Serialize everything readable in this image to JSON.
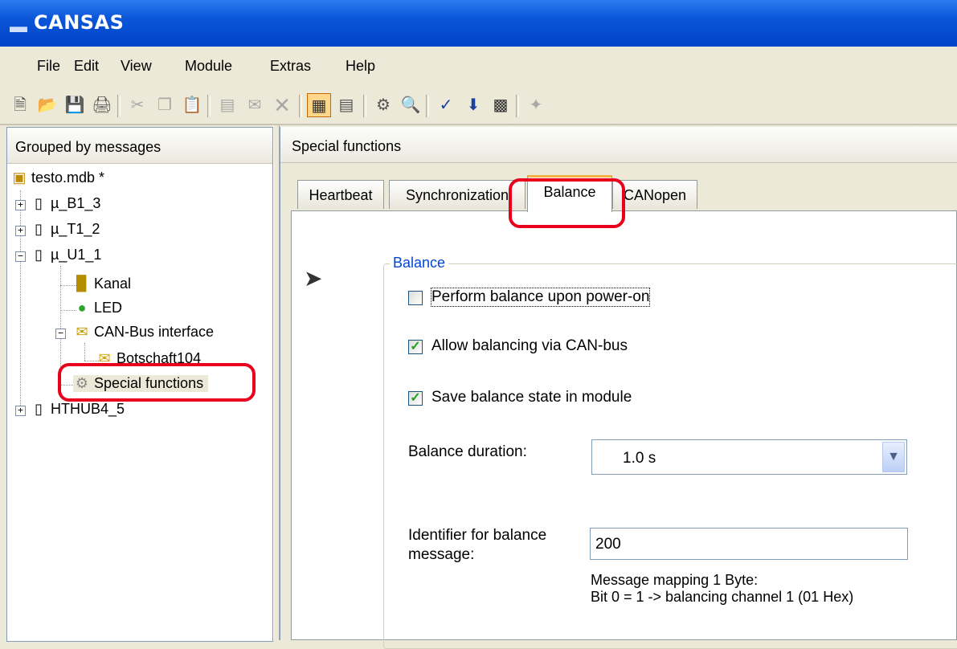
{
  "window": {
    "title": "CANSAS"
  },
  "menu": [
    {
      "label": "File"
    },
    {
      "label": "Edit"
    },
    {
      "label": "View"
    },
    {
      "label": "Module"
    },
    {
      "label": "Extras"
    },
    {
      "label": "Help"
    }
  ],
  "toolbar": {
    "icons": [
      "new-icon",
      "open-icon",
      "save-icon",
      "print-icon",
      "cut-icon",
      "copy-icon",
      "paste-icon",
      "add-channel-icon",
      "add-message-icon",
      "delete-icon",
      "grouped-by-messages-icon",
      "grouped-by-channels-icon",
      "search-modules-icon",
      "find-icon",
      "check-icon",
      "download-icon",
      "display-icon",
      "magic-wand-icon"
    ]
  },
  "left_pane": {
    "header": "Grouped by messages",
    "tree": {
      "root": "testo.mdb *",
      "m1": "µ_B1_3",
      "m2": "µ_T1_2",
      "m3": "µ_U1_1",
      "kanal": "Kanal",
      "led": "LED",
      "canbus": "CAN-Bus interface",
      "botschaft": "Botschaft104",
      "special": "Special functions",
      "m4": "HTHUB4_5"
    }
  },
  "right_pane": {
    "header": "Special functions",
    "tabs": [
      {
        "label": "Heartbeat"
      },
      {
        "label": "Synchronization"
      },
      {
        "label": "Balance",
        "selected": true
      },
      {
        "label": "CANopen"
      }
    ],
    "balance": {
      "group_title": "Balance",
      "perform_on_power_on": {
        "label": "Perform balance upon power-on",
        "checked": false
      },
      "allow_via_can": {
        "label": "Allow balancing via CAN-bus",
        "checked": true
      },
      "save_state": {
        "label": "Save balance state in module",
        "checked": true
      },
      "duration_label": "Balance duration:",
      "duration_value": "1.0  s",
      "identifier_label_1": "Identifier for balance",
      "identifier_label_2": "message:",
      "identifier_value": "200",
      "note_line1": "Message mapping 1 Byte:",
      "note_line2": "Bit 0 = 1 -> balancing channel 1 (01 Hex)"
    }
  },
  "colors": {
    "highlight": "#e8001c",
    "title_bar": "#0a55d8",
    "group_title": "#0046d5"
  }
}
